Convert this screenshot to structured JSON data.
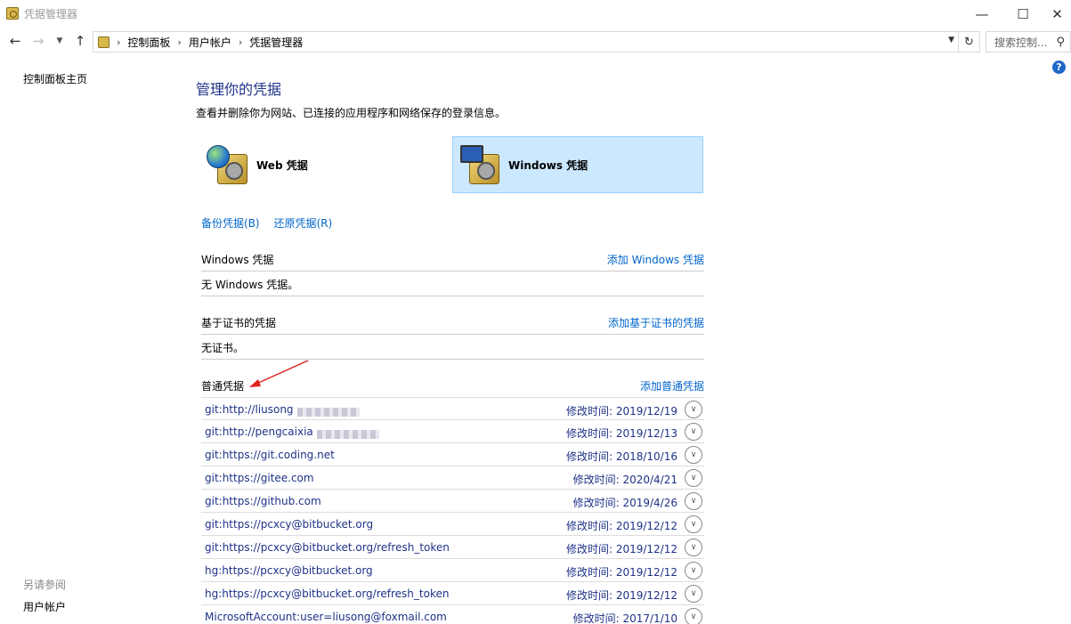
{
  "window": {
    "title": "凭据管理器"
  },
  "nav": {
    "breadcrumb": [
      "控制面板",
      "用户帐户",
      "凭据管理器"
    ],
    "search_placeholder": "搜索控制..."
  },
  "left": {
    "home": "控制面板主页",
    "see_also": "另请参阅",
    "user_accounts": "用户帐户"
  },
  "main": {
    "title": "管理你的凭据",
    "description": "查看并删除你为网站、已连接的应用程序和网络保存的登录信息。",
    "tiles": [
      {
        "label": "Web 凭据",
        "icon": "web-credentials-icon"
      },
      {
        "label": "Windows 凭据",
        "icon": "windows-credentials-icon",
        "selected": true
      }
    ],
    "backup": "备份凭据(B)",
    "restore": "还原凭据(R)",
    "windows_section": {
      "title": "Windows 凭据",
      "add": "添加 Windows 凭据",
      "empty": "无 Windows 凭据。"
    },
    "cert_section": {
      "title": "基于证书的凭据",
      "add": "添加基于证书的凭据",
      "empty": "无证书。"
    },
    "generic_section": {
      "title": "普通凭据",
      "add": "添加普通凭据"
    },
    "credentials": [
      {
        "name": "git:http://liusong",
        "blurred": true,
        "modified": "修改时间:  2019/12/19"
      },
      {
        "name": "git:http://pengcaixia",
        "blurred": true,
        "modified": "修改时间:  2019/12/13"
      },
      {
        "name": "git:https://git.coding.net",
        "blurred": false,
        "modified": "修改时间:  2018/10/16"
      },
      {
        "name": "git:https://gitee.com",
        "blurred": false,
        "modified": "修改时间:  2020/4/21"
      },
      {
        "name": "git:https://github.com",
        "blurred": false,
        "modified": "修改时间:  2019/4/26"
      },
      {
        "name": "git:https://pcxcy@bitbucket.org",
        "blurred": false,
        "modified": "修改时间:  2019/12/12"
      },
      {
        "name": "git:https://pcxcy@bitbucket.org/refresh_token",
        "blurred": false,
        "modified": "修改时间:  2019/12/12"
      },
      {
        "name": "hg:https://pcxcy@bitbucket.org",
        "blurred": false,
        "modified": "修改时间:  2019/12/12"
      },
      {
        "name": "hg:https://pcxcy@bitbucket.org/refresh_token",
        "blurred": false,
        "modified": "修改时间:  2019/12/12"
      },
      {
        "name": "MicrosoftAccount:user=liusong@foxmail.com",
        "blurred": false,
        "modified": "修改时间:  2017/1/10"
      }
    ]
  },
  "colors": {
    "accent": "#0066cc",
    "title": "#1e3287",
    "selected_tile": "#cce8ff",
    "annotation_arrow": "#e02020"
  }
}
